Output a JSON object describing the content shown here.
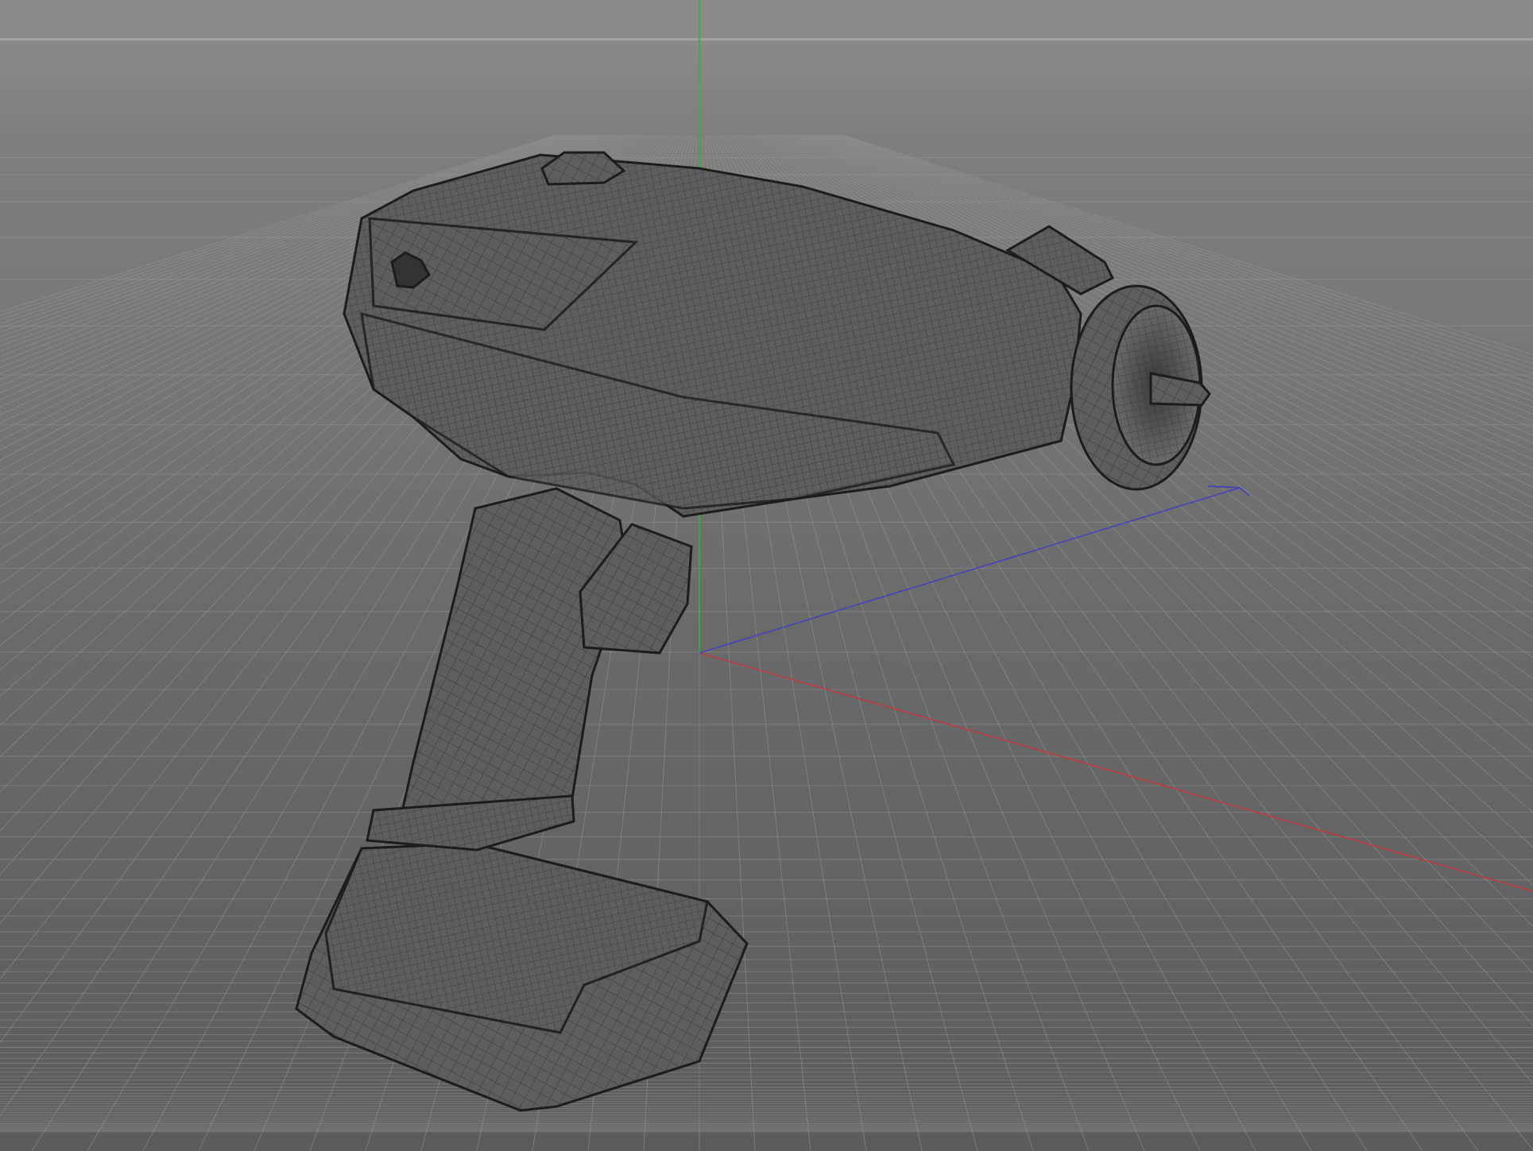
{
  "viewport": {
    "name": "3d-perspective-viewport",
    "display_mode": "wireframe-shaded",
    "object": "cordless-drill-mesh",
    "axes": {
      "x_color": "#c8353a",
      "y_color": "#2fb53a",
      "z_color": "#3e3ec4"
    },
    "grid": true,
    "colors": {
      "background_top": "#8e8e8e",
      "background_bottom": "#5c5c5c",
      "mesh_fill": "#5e5e5e",
      "mesh_wire": "#1c1c1c",
      "grid_line": "#9a9a9a"
    }
  }
}
